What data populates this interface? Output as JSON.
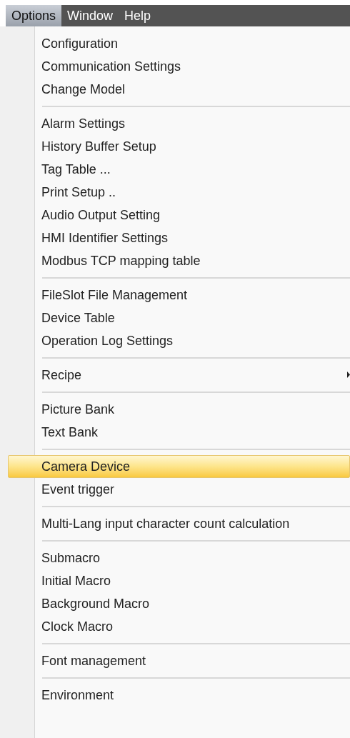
{
  "menu_bar": [
    {
      "label": "Options",
      "selected": true
    },
    {
      "label": "Window",
      "selected": false
    },
    {
      "label": "Help",
      "selected": false
    }
  ],
  "menu": [
    {
      "kind": "item",
      "label": "Configuration",
      "selected": false,
      "has_submenu": false
    },
    {
      "kind": "item",
      "label": "Communication Settings",
      "selected": false,
      "has_submenu": false
    },
    {
      "kind": "item",
      "label": "Change Model",
      "selected": false,
      "has_submenu": false
    },
    {
      "kind": "separator"
    },
    {
      "kind": "item",
      "label": "Alarm Settings",
      "selected": false,
      "has_submenu": false
    },
    {
      "kind": "item",
      "label": "History Buffer Setup",
      "selected": false,
      "has_submenu": false
    },
    {
      "kind": "item",
      "label": "Tag Table ...",
      "selected": false,
      "has_submenu": false
    },
    {
      "kind": "item",
      "label": "Print Setup ..",
      "selected": false,
      "has_submenu": false
    },
    {
      "kind": "item",
      "label": "Audio Output Setting",
      "selected": false,
      "has_submenu": false
    },
    {
      "kind": "item",
      "label": "HMI Identifier Settings",
      "selected": false,
      "has_submenu": false
    },
    {
      "kind": "item",
      "label": "Modbus TCP mapping table",
      "selected": false,
      "has_submenu": false
    },
    {
      "kind": "separator"
    },
    {
      "kind": "item",
      "label": "FileSlot File Management",
      "selected": false,
      "has_submenu": false
    },
    {
      "kind": "item",
      "label": "Device Table",
      "selected": false,
      "has_submenu": false
    },
    {
      "kind": "item",
      "label": "Operation Log Settings",
      "selected": false,
      "has_submenu": false
    },
    {
      "kind": "separator"
    },
    {
      "kind": "item",
      "label": "Recipe",
      "selected": false,
      "has_submenu": true
    },
    {
      "kind": "separator"
    },
    {
      "kind": "item",
      "label": "Picture Bank",
      "selected": false,
      "has_submenu": false
    },
    {
      "kind": "item",
      "label": "Text Bank",
      "selected": false,
      "has_submenu": false
    },
    {
      "kind": "separator"
    },
    {
      "kind": "item",
      "label": "Camera Device",
      "selected": true,
      "has_submenu": false
    },
    {
      "kind": "item",
      "label": "Event trigger",
      "selected": false,
      "has_submenu": false
    },
    {
      "kind": "separator"
    },
    {
      "kind": "item",
      "label": "Multi-Lang input character count calculation",
      "selected": false,
      "has_submenu": false
    },
    {
      "kind": "separator"
    },
    {
      "kind": "item",
      "label": "Submacro",
      "selected": false,
      "has_submenu": false
    },
    {
      "kind": "item",
      "label": "Initial Macro",
      "selected": false,
      "has_submenu": false
    },
    {
      "kind": "item",
      "label": "Background Macro",
      "selected": false,
      "has_submenu": false
    },
    {
      "kind": "item",
      "label": "Clock Macro",
      "selected": false,
      "has_submenu": false
    },
    {
      "kind": "separator"
    },
    {
      "kind": "item",
      "label": "Font management",
      "selected": false,
      "has_submenu": false
    },
    {
      "kind": "separator"
    },
    {
      "kind": "item",
      "label": "Environment",
      "selected": false,
      "has_submenu": false
    }
  ]
}
